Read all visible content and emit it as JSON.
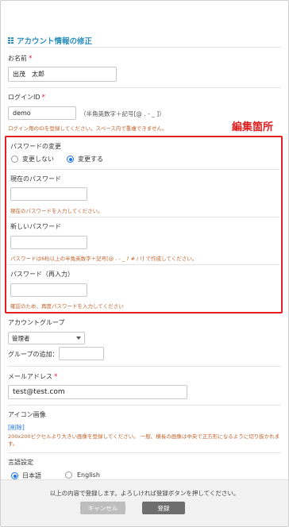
{
  "page": {
    "title": "アカウント情報の修正",
    "edit_annotation": "編集箇所"
  },
  "fields": {
    "name": {
      "label": "お名前",
      "required": "*",
      "value": "出茂　太郎"
    },
    "login_id": {
      "label": "ログインID",
      "required": "*",
      "value": "demo",
      "format_hint": "（半角英数字＋記号[@ . - _ ]）",
      "hint": "ログイン用のIDを登録してください。スペース内で重複できません。"
    },
    "password_change": {
      "label": "パスワードの変更",
      "options": [
        "変更しない",
        "変更する"
      ],
      "selected": "変更する"
    },
    "current_password": {
      "label": "現在のパスワード",
      "hint": "現在のパスワードを入力してください。"
    },
    "new_password": {
      "label": "新しいパスワード",
      "hint": "パスワードは6桁以上の半角英数字＋記号[@ . - _ ? # / !] で作成してください。"
    },
    "password_confirm": {
      "label": "パスワード（再入力）",
      "hint": "確認のため、再度パスワードを入力してください"
    },
    "account_group": {
      "label": "アカウントグループ",
      "selected": "管理者",
      "add_label": "グループの追加："
    },
    "email": {
      "label": "メールアドレス",
      "required": "*",
      "value": "test@test.com"
    },
    "icon_image": {
      "label": "アイコン画像",
      "delete_link": "[削除]",
      "hint": "200x200ピクセルより大きい画像を登録してください。 一般、横長の画像は中央で正方形になるように切り抜かれます。"
    },
    "language": {
      "label": "言語設定",
      "options": [
        "日本語",
        "English"
      ],
      "selected": "日本語"
    }
  },
  "footer": {
    "message": "以上の内容で登録します。よろしければ登録ボタンを押してください。",
    "cancel_label": "キャンセル",
    "submit_label": "登録"
  },
  "colors": {
    "accent": "#2a8fbd",
    "required": "#e0282d",
    "highlight": "#e02020",
    "hint": "#c2622a",
    "radio": "#1a73e8"
  }
}
